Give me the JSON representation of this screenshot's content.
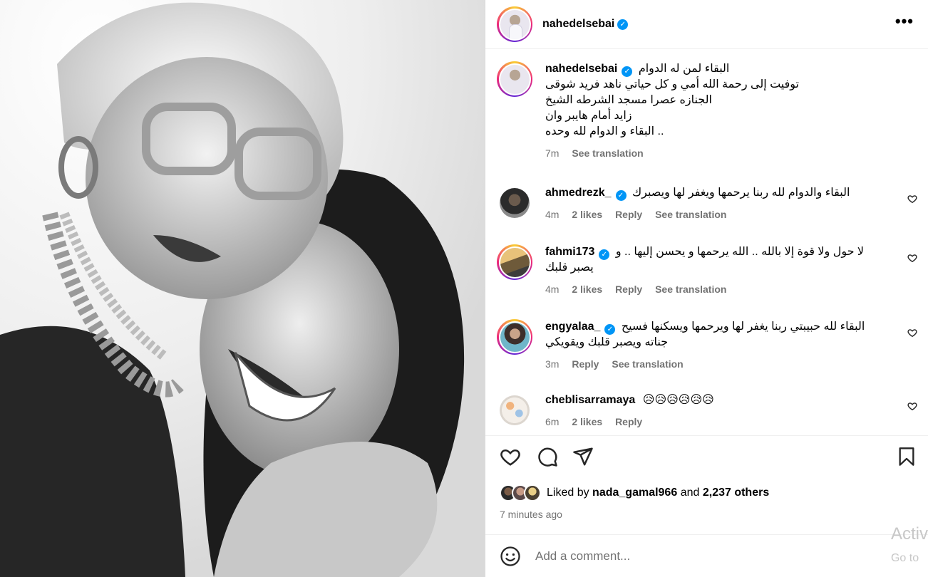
{
  "post": {
    "author": "nahedelsebai",
    "verified_mark": "✓",
    "more_icon": "•••"
  },
  "caption": {
    "username": "nahedelsebai",
    "lines": [
      "البقاء لمن له الدوام",
      "توفيت إلى رحمة الله أمي و كل حياتي ناهد فريد شوقى",
      "الجنازه عصرا مسجد الشرطه الشيخ",
      "زايد أمام هايبر وان",
      "البقاء و الدوام لله وحده .."
    ],
    "time": "7m",
    "see_translation": "See translation"
  },
  "comments": [
    {
      "username": "ahmedrezk_",
      "text": "البقاء والدوام لله ربنا يرحمها ويغفر لها ويصبرك",
      "time": "4m",
      "likes": "2 likes",
      "reply": "Reply",
      "see_translation": "See translation"
    },
    {
      "username": "fahmi173",
      "text": "لا حول ولا قوة إلا بالله .. الله يرحمها و يحسن إليها .. و يصبر قلبك",
      "time": "4m",
      "likes": "2 likes",
      "reply": "Reply",
      "see_translation": "See translation"
    },
    {
      "username": "engyalaa_",
      "text": "البقاء لله حبيبتي ربنا يغفر لها ويرحمها ويسكنها فسيح جناته ويصبر قلبك ويقويكي",
      "time": "3m",
      "reply": "Reply",
      "see_translation": "See translation"
    },
    {
      "username": "cheblisarramaya",
      "text": "😥😥😥😥😥😥",
      "time": "6m",
      "likes": "2 likes",
      "reply": "Reply"
    }
  ],
  "likes": {
    "prefix": "Liked by",
    "user": "nada_gamal966",
    "and": "and",
    "others": "2,237 others"
  },
  "time_ago": "7 minutes ago",
  "add_comment": {
    "placeholder": "Add a comment..."
  },
  "watermark": {
    "line1": "Activ",
    "line2": "Go to"
  },
  "colors": {
    "accent": "#0095f6",
    "muted": "#737373",
    "divider": "#efefef"
  }
}
